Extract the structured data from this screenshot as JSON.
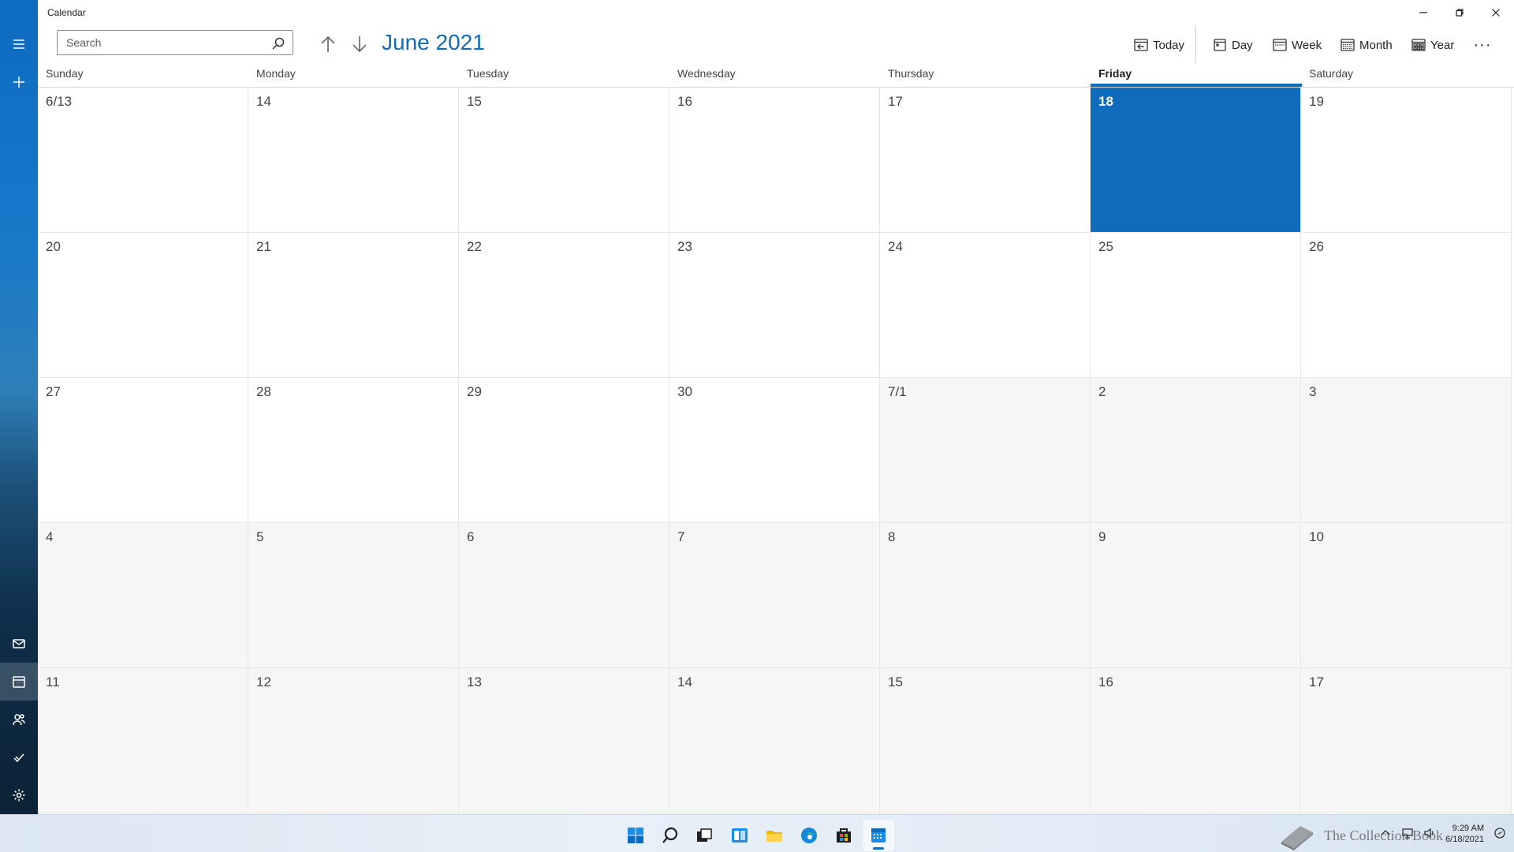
{
  "app": {
    "title": "Calendar"
  },
  "search": {
    "placeholder": "Search"
  },
  "header": {
    "month_title": "June 2021"
  },
  "toolbar": {
    "today_label": "Today",
    "day_label": "Day",
    "week_label": "Week",
    "month_label": "Month",
    "year_label": "Year",
    "more_label": "···"
  },
  "weekdays": [
    "Sunday",
    "Monday",
    "Tuesday",
    "Wednesday",
    "Thursday",
    "Friday",
    "Saturday"
  ],
  "weeks": [
    [
      "6/13",
      "14",
      "15",
      "16",
      "17",
      "18",
      "19"
    ],
    [
      "20",
      "21",
      "22",
      "23",
      "24",
      "25",
      "26"
    ],
    [
      "27",
      "28",
      "29",
      "30",
      "7/1",
      "2",
      "3"
    ],
    [
      "4",
      "5",
      "6",
      "7",
      "8",
      "9",
      "10"
    ],
    [
      "11",
      "12",
      "13",
      "14",
      "15",
      "16",
      "17"
    ]
  ],
  "calendar_state": {
    "today_week": 0,
    "today_day": 5,
    "out_of_month_start_week": 2,
    "out_of_month_start_day": 4
  },
  "taskbar": {
    "clock_time": "9:29 AM",
    "clock_date": "6/18/2021",
    "watermark": "The Collection Book",
    "icons": [
      "windows-start-icon",
      "search-icon",
      "task-view-icon",
      "widgets-icon",
      "file-explorer-icon",
      "edge-icon",
      "store-icon",
      "calendar-app-icon"
    ]
  },
  "colors": {
    "accent": "#0f6cbd",
    "out_of_month": "#f6f6f6",
    "grid_line": "#e6e6e6"
  }
}
